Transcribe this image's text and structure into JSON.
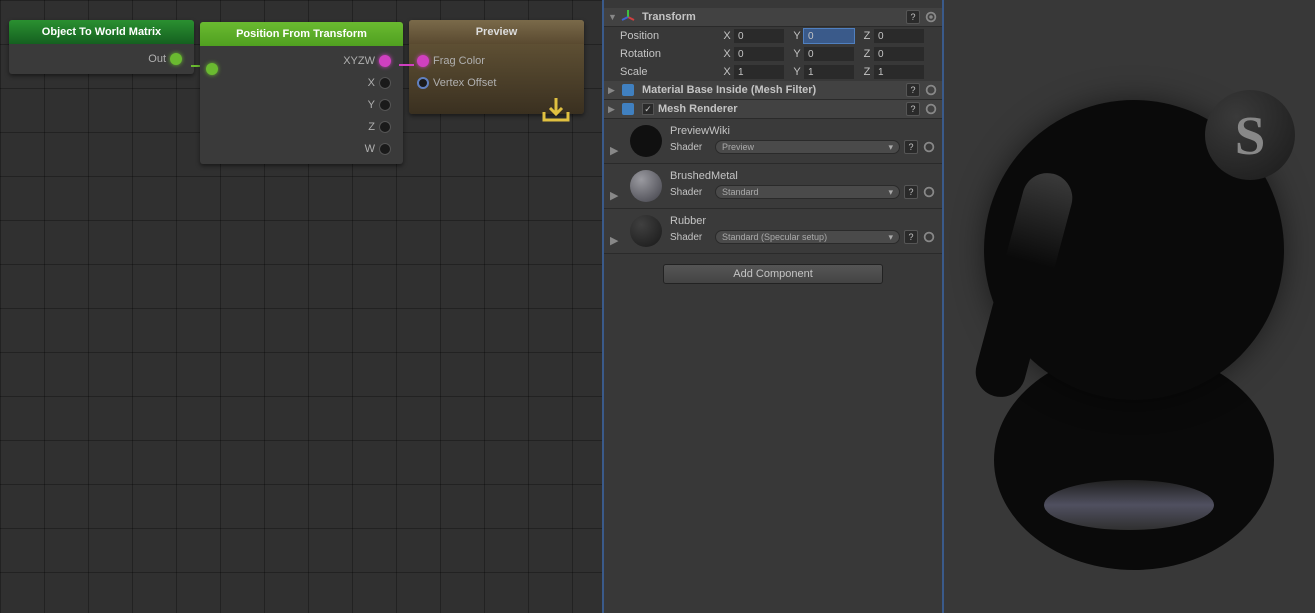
{
  "nodes": {
    "n1": {
      "title": "Object To World Matrix",
      "out": "Out"
    },
    "n2": {
      "title": "Position From Transform",
      "ports": [
        "XYZW",
        "X",
        "Y",
        "Z",
        "W"
      ]
    },
    "n3": {
      "title": "Preview",
      "inputs": [
        "Frag Color",
        "Vertex Offset"
      ]
    }
  },
  "inspector": {
    "transform": {
      "title": "Transform",
      "position": {
        "label": "Position",
        "x": "0",
        "y": "0",
        "z": "0"
      },
      "rotation": {
        "label": "Rotation",
        "x": "0",
        "y": "0",
        "z": "0"
      },
      "scale": {
        "label": "Scale",
        "x": "1",
        "y": "1",
        "z": "1"
      }
    },
    "meshFilter": {
      "title": "Material Base Inside (Mesh Filter)"
    },
    "meshRenderer": {
      "title": "Mesh Renderer",
      "checked": true
    },
    "materials": [
      {
        "name": "PreviewWiki",
        "shader": "Preview",
        "sphere": "#101010"
      },
      {
        "name": "BrushedMetal",
        "shader": "Standard",
        "sphere": "radial-gradient(circle at 35% 30%, #9a9aa0, #404048)"
      },
      {
        "name": "Rubber",
        "shader": "Standard (Specular setup)",
        "sphere": "radial-gradient(circle at 35% 30%, #404040, #181818)"
      }
    ],
    "shaderLabel": "Shader",
    "addComponent": "Add Component"
  }
}
